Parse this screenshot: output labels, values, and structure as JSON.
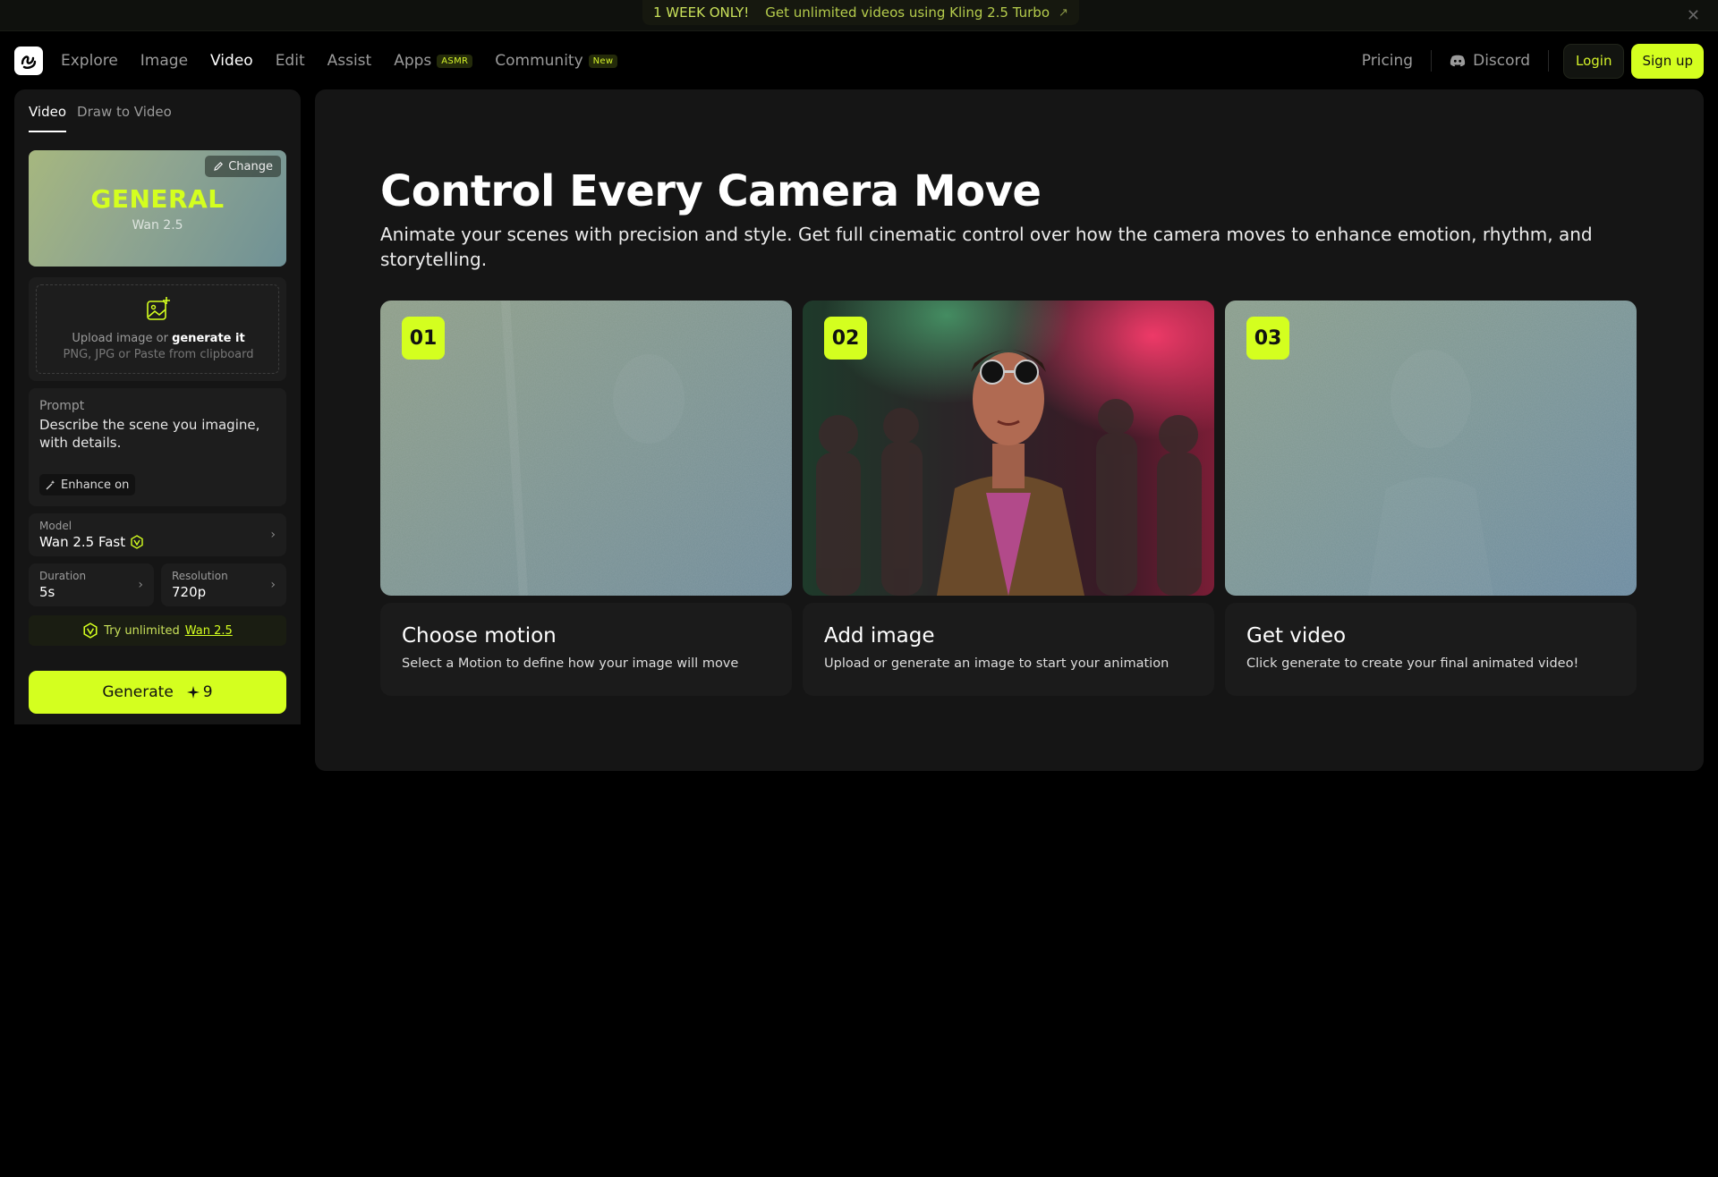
{
  "promo": {
    "tag": "1 WEEK ONLY!",
    "text": "Get unlimited videos using Kling 2.5 Turbo",
    "arrow": "↗",
    "close": "✕"
  },
  "nav": {
    "links": [
      {
        "label": "Explore"
      },
      {
        "label": "Image"
      },
      {
        "label": "Video"
      },
      {
        "label": "Edit"
      },
      {
        "label": "Assist"
      },
      {
        "label": "Apps",
        "badge": "ASMR"
      },
      {
        "label": "Community",
        "badge": "New"
      }
    ],
    "pricing": "Pricing",
    "discord": "Discord",
    "login": "Login",
    "signup": "Sign up"
  },
  "sidebar": {
    "tabs": [
      "Video",
      "Draw to Video"
    ],
    "preset": {
      "change": "Change",
      "title": "GENERAL",
      "subtitle": "Wan 2.5"
    },
    "upload": {
      "text": "Upload image or ",
      "link": "generate it",
      "hint": "PNG, JPG or Paste from clipboard"
    },
    "prompt": {
      "label": "Prompt",
      "placeholder": "Describe the scene you imagine, with details.",
      "enhance": "Enhance on"
    },
    "model": {
      "label": "Model",
      "value": "Wan 2.5 Fast"
    },
    "duration": {
      "label": "Duration",
      "value": "5s"
    },
    "resolution": {
      "label": "Resolution",
      "value": "720p"
    },
    "try": {
      "text": "Try unlimited",
      "link": "Wan 2.5"
    },
    "generate": {
      "label": "Generate",
      "cost": "9"
    }
  },
  "main": {
    "title": "Control Every Camera Move",
    "description": "Animate your scenes with precision and style. Get full cinematic control over how the camera moves to enhance emotion, rhythm, and storytelling.",
    "cards": [
      {
        "number": "01",
        "title": "Choose motion",
        "text": "Select a Motion to define how your image will move"
      },
      {
        "number": "02",
        "title": "Add image",
        "text": "Upload or generate an image to start your animation"
      },
      {
        "number": "03",
        "title": "Get video",
        "text": "Click generate to create your final animated video!"
      }
    ]
  },
  "colors": {
    "accent": "#d4ff1f",
    "background": "#000000",
    "panel": "#151515"
  }
}
